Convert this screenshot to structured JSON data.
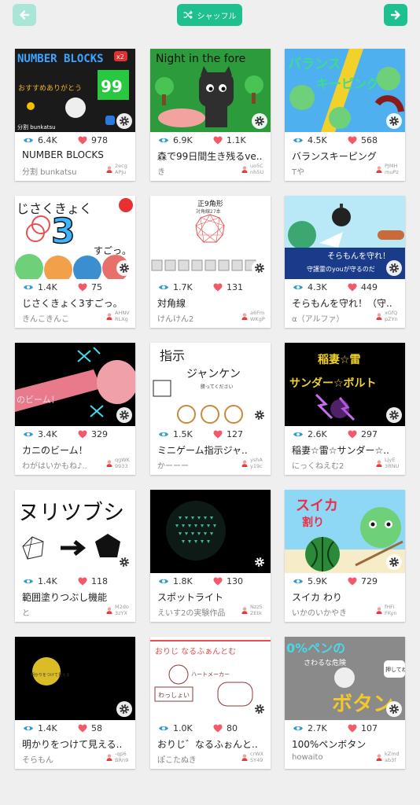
{
  "header": {
    "shuffle_label": "シャッフル",
    "prev_icon": "arrow-left-icon",
    "next_icon": "arrow-right-icon"
  },
  "colors": {
    "accent": "#1ec08f",
    "accent_light": "#a9e6d7",
    "like": "#f25a6b",
    "view": "#2b9bd6"
  },
  "cards": [
    {
      "thumb_text": "NUMBER BLOCKS",
      "thumb_sub": "おすすめありがとう",
      "thumb_badge": "99",
      "thumb_badge2": "x2",
      "thumb_caption": "分割 bunkatsu",
      "views": "6.4K",
      "likes": "978",
      "title": "NUMBER BLOCKS",
      "author": "分割 bunkatsu",
      "uid1": "2ecg",
      "uid2": "APju"
    },
    {
      "thumb_text": "Night in the fore",
      "views": "6.9K",
      "likes": "1.1K",
      "title": "森で99日間生き残るve..",
      "author": "き",
      "uid1": "uo5C",
      "uid2": "nh5U"
    },
    {
      "thumb_text": "バランス",
      "thumb_sub": "キーピング",
      "views": "4.5K",
      "likes": "568",
      "title": "バランスキーピング",
      "author": "Tや",
      "uid1": "PJMH",
      "uid2": "muPz"
    },
    {
      "thumb_text": "じさくきょく",
      "thumb_badge": "3",
      "thumb_sub": "すごっ。",
      "views": "1.4K",
      "likes": "75",
      "title": "じさくきょく3すごっ。",
      "author": "きんこきんこ",
      "uid1": "AHNV",
      "uid2": "RLXg"
    },
    {
      "thumb_text": "正9角形",
      "thumb_sub": "対角線27本",
      "views": "1.7K",
      "likes": "131",
      "title": "対角線",
      "author": "けんけん2",
      "uid1": "a6Fm",
      "uid2": "WKgP"
    },
    {
      "thumb_text": "そらもんを守れ！",
      "thumb_sub": "守護霊のyouが守るのだ",
      "views": "4.3K",
      "likes": "449",
      "title": "そらもんを守れ！（守..",
      "author": "α（アルファ）",
      "uid1": "xGfQ",
      "uid2": "pZYn"
    },
    {
      "thumb_text": "のビーム！",
      "views": "3.4K",
      "likes": "329",
      "title": "カニのビーム！",
      "author": "わがはいかもね♪..",
      "uid1": "qgWK",
      "uid2": "9933"
    },
    {
      "thumb_text": "指示",
      "thumb_sub": "ジャンケン",
      "thumb_caption": "勝ってください",
      "views": "1.5K",
      "likes": "127",
      "title": "ミニゲーム指示ジャ..",
      "author": "かーーー",
      "uid1": "yshA",
      "uid2": "y19c"
    },
    {
      "thumb_text": "稲妻☆雷",
      "thumb_sub": "サンダー☆ボルト",
      "views": "2.6K",
      "likes": "297",
      "title": "稲妻☆雷☆サンダー☆..",
      "author": "にっくねえむ2",
      "uid1": "LjyE",
      "uid2": "3RNU"
    },
    {
      "thumb_text": "ヌリツブシ",
      "views": "1.4K",
      "likes": "118",
      "title": "範囲塗りつぶし機能",
      "author": "と",
      "uid1": "M2do",
      "uid2": "3zYX"
    },
    {
      "thumb_text": "",
      "views": "1.8K",
      "likes": "130",
      "title": "スポットライト",
      "author": "えいす2の実験作品",
      "uid1": "Nzz5",
      "uid2": "ZEtk"
    },
    {
      "thumb_text": "スイカ",
      "thumb_sub": "割り",
      "views": "5.9K",
      "likes": "729",
      "title": "スイカ わり",
      "author": "いかのいかやき",
      "uid1": "fHFi",
      "uid2": "FKyn"
    },
    {
      "thumb_text": "明かりをつけて見える",
      "views": "1.4K",
      "likes": "58",
      "title": "明かりをつけて見える..",
      "author": "そらもん",
      "uid1": "-qp6",
      "uid2": "BRn9"
    },
    {
      "thumb_text": "おりじ なるふぁんとむ",
      "thumb_sub": "わっしょい",
      "thumb_caption": "ハートメーカー",
      "views": "1.0K",
      "likes": "80",
      "title": "おりじ゛なるふぉんと..",
      "author": "ぽこたぬき",
      "uid1": "crWX",
      "uid2": "SY49"
    },
    {
      "thumb_text": "0%ペンの",
      "thumb_sub": "ボタン",
      "thumb_caption": "さわるな危険",
      "thumb_badge": "押してね",
      "views": "2.7K",
      "likes": "107",
      "title": "100%ペンボタン",
      "author": "howaito",
      "uid1": "kZmd",
      "uid2": "ab3f"
    }
  ]
}
